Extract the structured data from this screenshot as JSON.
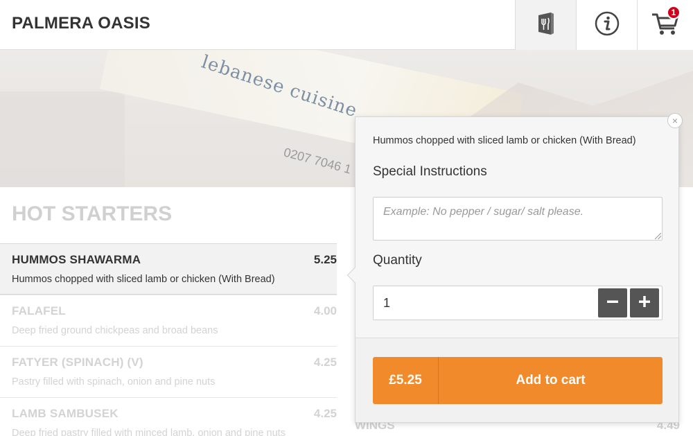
{
  "header": {
    "title": "PALMERA OASIS",
    "cart_count": "1",
    "icons": [
      "menu-icon",
      "info-icon",
      "cart-icon"
    ]
  },
  "hero": {
    "sign_text": "lebanese cuisine",
    "phone_text": "0207 7046 1"
  },
  "section": {
    "title": "HOT STARTERS"
  },
  "items": [
    {
      "name": "HUMMOS SHAWARMA",
      "price": "5.25",
      "desc": "Hummos chopped with sliced lamb or chicken (With Bread)"
    },
    {
      "name": "FALAFEL",
      "price": "4.00",
      "desc": "Deep fried ground chickpeas and broad beans"
    },
    {
      "name": "FATYER (SPINACH) (V)",
      "price": "4.25",
      "desc": "Pastry filled with spinach, onion and pine nuts"
    },
    {
      "name": "LAMB SAMBUSEK",
      "price": "4.25",
      "desc": "Deep fried pastry filled with minced lamb, onion and pine nuts"
    }
  ],
  "right_column": {
    "item_name": "WINGS",
    "item_price": "4.49"
  },
  "popup": {
    "description": "Hummos chopped with sliced lamb or chicken (With Bread)",
    "special_instructions_label": "Special Instructions",
    "special_instructions_placeholder": "Example: No pepper / sugar/ salt please.",
    "quantity_label": "Quantity",
    "quantity_value": "1",
    "price": "£5.25",
    "add_to_cart_label": "Add to cart"
  },
  "colors": {
    "accent": "#f18a2b",
    "badge": "#d0021b",
    "stepper": "#555555"
  }
}
